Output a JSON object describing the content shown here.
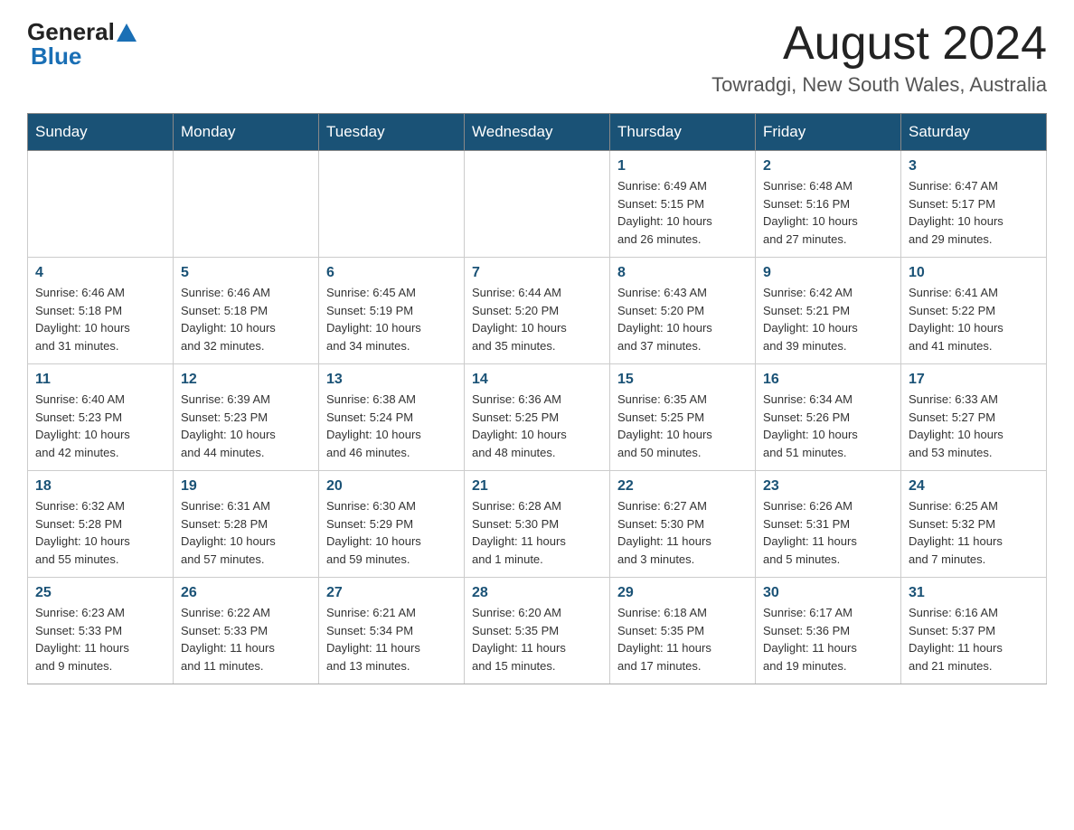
{
  "header": {
    "logo_general": "General",
    "logo_blue": "Blue",
    "month_title": "August 2024",
    "location": "Towradgi, New South Wales, Australia"
  },
  "days_of_week": [
    "Sunday",
    "Monday",
    "Tuesday",
    "Wednesday",
    "Thursday",
    "Friday",
    "Saturday"
  ],
  "weeks": [
    [
      {
        "day": "",
        "info": ""
      },
      {
        "day": "",
        "info": ""
      },
      {
        "day": "",
        "info": ""
      },
      {
        "day": "",
        "info": ""
      },
      {
        "day": "1",
        "info": "Sunrise: 6:49 AM\nSunset: 5:15 PM\nDaylight: 10 hours\nand 26 minutes."
      },
      {
        "day": "2",
        "info": "Sunrise: 6:48 AM\nSunset: 5:16 PM\nDaylight: 10 hours\nand 27 minutes."
      },
      {
        "day": "3",
        "info": "Sunrise: 6:47 AM\nSunset: 5:17 PM\nDaylight: 10 hours\nand 29 minutes."
      }
    ],
    [
      {
        "day": "4",
        "info": "Sunrise: 6:46 AM\nSunset: 5:18 PM\nDaylight: 10 hours\nand 31 minutes."
      },
      {
        "day": "5",
        "info": "Sunrise: 6:46 AM\nSunset: 5:18 PM\nDaylight: 10 hours\nand 32 minutes."
      },
      {
        "day": "6",
        "info": "Sunrise: 6:45 AM\nSunset: 5:19 PM\nDaylight: 10 hours\nand 34 minutes."
      },
      {
        "day": "7",
        "info": "Sunrise: 6:44 AM\nSunset: 5:20 PM\nDaylight: 10 hours\nand 35 minutes."
      },
      {
        "day": "8",
        "info": "Sunrise: 6:43 AM\nSunset: 5:20 PM\nDaylight: 10 hours\nand 37 minutes."
      },
      {
        "day": "9",
        "info": "Sunrise: 6:42 AM\nSunset: 5:21 PM\nDaylight: 10 hours\nand 39 minutes."
      },
      {
        "day": "10",
        "info": "Sunrise: 6:41 AM\nSunset: 5:22 PM\nDaylight: 10 hours\nand 41 minutes."
      }
    ],
    [
      {
        "day": "11",
        "info": "Sunrise: 6:40 AM\nSunset: 5:23 PM\nDaylight: 10 hours\nand 42 minutes."
      },
      {
        "day": "12",
        "info": "Sunrise: 6:39 AM\nSunset: 5:23 PM\nDaylight: 10 hours\nand 44 minutes."
      },
      {
        "day": "13",
        "info": "Sunrise: 6:38 AM\nSunset: 5:24 PM\nDaylight: 10 hours\nand 46 minutes."
      },
      {
        "day": "14",
        "info": "Sunrise: 6:36 AM\nSunset: 5:25 PM\nDaylight: 10 hours\nand 48 minutes."
      },
      {
        "day": "15",
        "info": "Sunrise: 6:35 AM\nSunset: 5:25 PM\nDaylight: 10 hours\nand 50 minutes."
      },
      {
        "day": "16",
        "info": "Sunrise: 6:34 AM\nSunset: 5:26 PM\nDaylight: 10 hours\nand 51 minutes."
      },
      {
        "day": "17",
        "info": "Sunrise: 6:33 AM\nSunset: 5:27 PM\nDaylight: 10 hours\nand 53 minutes."
      }
    ],
    [
      {
        "day": "18",
        "info": "Sunrise: 6:32 AM\nSunset: 5:28 PM\nDaylight: 10 hours\nand 55 minutes."
      },
      {
        "day": "19",
        "info": "Sunrise: 6:31 AM\nSunset: 5:28 PM\nDaylight: 10 hours\nand 57 minutes."
      },
      {
        "day": "20",
        "info": "Sunrise: 6:30 AM\nSunset: 5:29 PM\nDaylight: 10 hours\nand 59 minutes."
      },
      {
        "day": "21",
        "info": "Sunrise: 6:28 AM\nSunset: 5:30 PM\nDaylight: 11 hours\nand 1 minute."
      },
      {
        "day": "22",
        "info": "Sunrise: 6:27 AM\nSunset: 5:30 PM\nDaylight: 11 hours\nand 3 minutes."
      },
      {
        "day": "23",
        "info": "Sunrise: 6:26 AM\nSunset: 5:31 PM\nDaylight: 11 hours\nand 5 minutes."
      },
      {
        "day": "24",
        "info": "Sunrise: 6:25 AM\nSunset: 5:32 PM\nDaylight: 11 hours\nand 7 minutes."
      }
    ],
    [
      {
        "day": "25",
        "info": "Sunrise: 6:23 AM\nSunset: 5:33 PM\nDaylight: 11 hours\nand 9 minutes."
      },
      {
        "day": "26",
        "info": "Sunrise: 6:22 AM\nSunset: 5:33 PM\nDaylight: 11 hours\nand 11 minutes."
      },
      {
        "day": "27",
        "info": "Sunrise: 6:21 AM\nSunset: 5:34 PM\nDaylight: 11 hours\nand 13 minutes."
      },
      {
        "day": "28",
        "info": "Sunrise: 6:20 AM\nSunset: 5:35 PM\nDaylight: 11 hours\nand 15 minutes."
      },
      {
        "day": "29",
        "info": "Sunrise: 6:18 AM\nSunset: 5:35 PM\nDaylight: 11 hours\nand 17 minutes."
      },
      {
        "day": "30",
        "info": "Sunrise: 6:17 AM\nSunset: 5:36 PM\nDaylight: 11 hours\nand 19 minutes."
      },
      {
        "day": "31",
        "info": "Sunrise: 6:16 AM\nSunset: 5:37 PM\nDaylight: 11 hours\nand 21 minutes."
      }
    ]
  ]
}
